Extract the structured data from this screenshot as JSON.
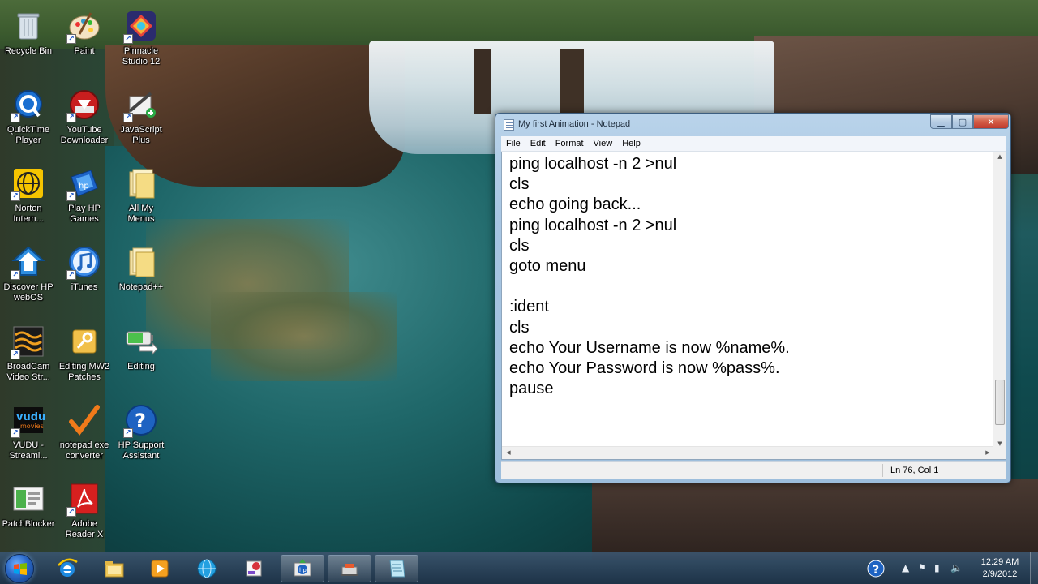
{
  "desktop_icons": [
    {
      "label": "Recycle Bin",
      "icon": "recycle-bin-icon"
    },
    {
      "label": "Paint",
      "icon": "paint-icon"
    },
    {
      "label": "Pinnacle\nStudio 12",
      "icon": "pinnacle-studio-icon"
    },
    {
      "label": "QuickTime\nPlayer",
      "icon": "quicktime-icon"
    },
    {
      "label": "YouTube\nDownloader",
      "icon": "youtube-downloader-icon"
    },
    {
      "label": "JavaScript\nPlus",
      "icon": "javascript-plus-icon"
    },
    {
      "label": "Norton\nIntern...",
      "icon": "norton-icon"
    },
    {
      "label": "Play HP\nGames",
      "icon": "hp-games-icon"
    },
    {
      "label": "All My\nMenus",
      "icon": "folder-icon"
    },
    {
      "label": "Discover HP\nwebOS",
      "icon": "hp-webos-icon"
    },
    {
      "label": "iTunes",
      "icon": "itunes-icon"
    },
    {
      "label": "Notepad++",
      "icon": "folder-icon"
    },
    {
      "label": "BroadCam\nVideo Str...",
      "icon": "broadcam-icon"
    },
    {
      "label": "Editing MW2\nPatches",
      "icon": "key-icon"
    },
    {
      "label": "Editing",
      "icon": "battery-icon"
    },
    {
      "label": "VUDU -\nStreami...",
      "icon": "vudu-icon"
    },
    {
      "label": "notepad exe\nconverter",
      "icon": "checkmark-icon"
    },
    {
      "label": "HP Support\nAssistant",
      "icon": "help-icon"
    },
    {
      "label": "PatchBlocker",
      "icon": "patchblocker-icon"
    },
    {
      "label": "Adobe\nReader X",
      "icon": "adobe-reader-icon"
    }
  ],
  "notepad": {
    "title": "My first Animation - Notepad",
    "menu": [
      "File",
      "Edit",
      "Format",
      "View",
      "Help"
    ],
    "content": "ping localhost -n 2 >nul\ncls\necho going back...\nping localhost -n 2 >nul\ncls\ngoto menu\n\n:ident\ncls\necho Your Username is now %name%.\necho Your Password is now %pass%.\npause",
    "status": "Ln 76, Col 1",
    "controls": {
      "minimize": "▁",
      "maximize": "▢",
      "close": "✕"
    }
  },
  "taskbar": {
    "buttons": [
      {
        "name": "internet-explorer",
        "state": "pinned"
      },
      {
        "name": "windows-explorer",
        "state": "pinned"
      },
      {
        "name": "media-player",
        "state": "pinned"
      },
      {
        "name": "globe-app",
        "state": "pinned"
      },
      {
        "name": "paint-app",
        "state": "pinned"
      },
      {
        "name": "hp-app",
        "state": "running"
      },
      {
        "name": "tools-app",
        "state": "running"
      },
      {
        "name": "notepad-app",
        "state": "running"
      }
    ],
    "clock": {
      "time": "12:29 AM",
      "date": "2/9/2012"
    }
  },
  "colors": {
    "accent": "#2a68c8",
    "close": "#c0392b"
  }
}
